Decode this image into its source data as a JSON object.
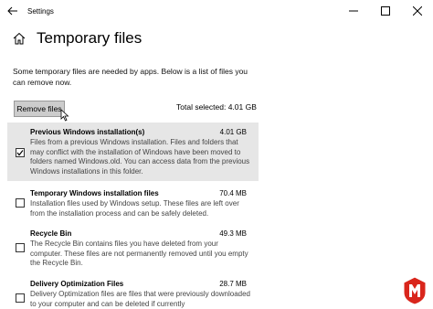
{
  "window": {
    "title": "Settings",
    "back_icon": "back-arrow-icon",
    "controls": [
      "minimize-icon",
      "maximize-icon",
      "close-icon"
    ]
  },
  "header": {
    "icon": "home-icon",
    "title": "Temporary files"
  },
  "intro": "Some temporary files are needed by apps. Below is a list of files you can remove now.",
  "remove_button": "Remove files",
  "total_selected": "Total selected: 4.01 GB",
  "items": [
    {
      "name": "Previous Windows installation(s)",
      "size": "4.01 GB",
      "checked": true,
      "description": "Files from a previous Windows installation.  Files and folders that may conflict with the installation of Windows have been moved to folders named Windows.old.  You can access data from the previous Windows installations in this folder."
    },
    {
      "name": "Temporary Windows installation files",
      "size": "70.4 MB",
      "checked": false,
      "description": "Installation files used by Windows setup.  These files are left over from the installation process and can be safely deleted."
    },
    {
      "name": "Recycle Bin",
      "size": "49.3 MB",
      "checked": false,
      "description": "The Recycle Bin contains files you have deleted from your computer.  These files are not permanently removed until you empty the Recycle Bin."
    },
    {
      "name": "Delivery Optimization Files",
      "size": "28.7 MB",
      "checked": false,
      "description": "Delivery Optimization files are files that were previously downloaded to your computer and can be deleted if currently"
    }
  ],
  "colors": {
    "selected_row": "#e6e6e6",
    "button_bg": "#cccccc",
    "watermark_red": "#d9261c"
  }
}
